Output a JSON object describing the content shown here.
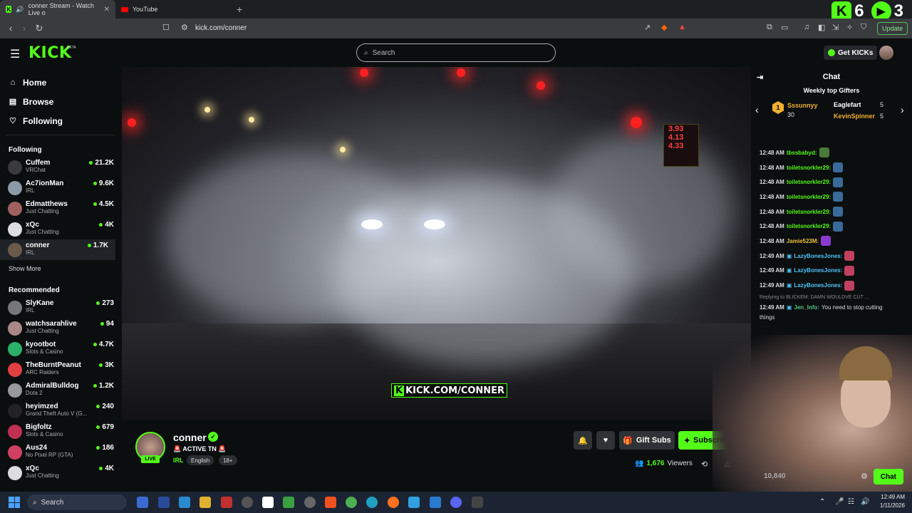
{
  "browser": {
    "tabs": [
      {
        "title": "conner Stream - Watch Live o"
      },
      {
        "title": "YouTube"
      }
    ],
    "url": "kick.com/conner",
    "update_label": "Update",
    "overlay_counts": {
      "kick": "6",
      "play": "3"
    }
  },
  "header": {
    "logo": "KICK",
    "beta": "BETA",
    "search_placeholder": "Search",
    "get_kicks": "Get KICKs"
  },
  "sidebar": {
    "nav": [
      {
        "label": "Home",
        "icon": "home-icon"
      },
      {
        "label": "Browse",
        "icon": "browse-icon"
      },
      {
        "label": "Following",
        "icon": "heart-icon"
      }
    ],
    "following_title": "Following",
    "following": [
      {
        "name": "Cuffem",
        "category": "VRChat",
        "viewers": "21.2K"
      },
      {
        "name": "Ac7ionMan",
        "category": "IRL",
        "viewers": "9.6K"
      },
      {
        "name": "Edmatthews",
        "category": "Just Chatting",
        "viewers": "4.5K"
      },
      {
        "name": "xQc",
        "category": "Just Chatting",
        "viewers": "4K"
      },
      {
        "name": "conner",
        "category": "IRL",
        "viewers": "1.7K"
      }
    ],
    "show_more": "Show More",
    "recommended_title": "Recommended",
    "recommended": [
      {
        "name": "SlyKane",
        "category": "IRL",
        "viewers": "273"
      },
      {
        "name": "watchsarahlive",
        "category": "Just Chatting",
        "viewers": "94"
      },
      {
        "name": "kyootbot",
        "category": "Slots & Casino",
        "viewers": "4.7K"
      },
      {
        "name": "TheBurntPeanut",
        "category": "ARC Raiders",
        "viewers": "3K"
      },
      {
        "name": "AdmiralBulldog",
        "category": "Dota 2",
        "viewers": "1.2K"
      },
      {
        "name": "heyimzed",
        "category": "Grand Theft Auto V (G...",
        "viewers": "240"
      },
      {
        "name": "Bigfoltz",
        "category": "Slots & Casino",
        "viewers": "679"
      },
      {
        "name": "Aus24",
        "category": "No Pixel RP (GTA)",
        "viewers": "186"
      },
      {
        "name": "xQc",
        "category": "Just Chatting",
        "viewers": "4K"
      }
    ]
  },
  "video": {
    "watermark": "KICK.COM/CONNER",
    "gas_prices": [
      "3.93",
      "4.13",
      "4.33"
    ]
  },
  "stream": {
    "name": "conner",
    "title": "🚨 ACTIVE TN 🚨",
    "category": "IRL",
    "tags": [
      "English",
      "18+"
    ],
    "live": "LIVE",
    "gift_subs": "Gift Subs",
    "subscribe": "Subscribe",
    "viewers": "1,676",
    "viewers_label": "Viewers"
  },
  "chat": {
    "title": "Chat",
    "gifters_title": "Weekly top Gifters",
    "gifters": [
      {
        "rank": "1",
        "name": "Sssunnyy",
        "count": "30"
      },
      {
        "name": "Eaglefart",
        "count": "5"
      },
      {
        "name": "KevinSpinner",
        "count": "5"
      }
    ],
    "messages": [
      {
        "time": "12:48 AM",
        "user": "tbssbabyd:",
        "color": "#53fc18"
      },
      {
        "time": "12:48 AM",
        "user": "toiletsnorkler29:",
        "color": "#53fc18"
      },
      {
        "time": "12:48 AM",
        "user": "toiletsnorkler29:",
        "color": "#53fc18"
      },
      {
        "time": "12:48 AM",
        "user": "toiletsnorkler29:",
        "color": "#53fc18"
      },
      {
        "time": "12:48 AM",
        "user": "toiletsnorkler29:",
        "color": "#53fc18"
      },
      {
        "time": "12:48 AM",
        "user": "toiletsnorkler29:",
        "color": "#53fc18"
      },
      {
        "time": "12:48 AM",
        "user": "Jamie523M:",
        "color": "#f0c040"
      },
      {
        "time": "12:49 AM",
        "user": "LazyBonesJones:",
        "color": "#4fc3f7"
      },
      {
        "time": "12:49 AM",
        "user": "LazyBonesJones:",
        "color": "#4fc3f7"
      },
      {
        "time": "12:49 AM",
        "user": "LazyBonesJones:",
        "color": "#4fc3f7"
      }
    ],
    "reply_to": "Replying to BLICKEM: DAMN WOULDVE CUT ...",
    "last_time": "12:49 AM",
    "last_user": "Jen_Info:",
    "last_text": "You need to stop cutting",
    "last_text2": "things",
    "points": "10,840",
    "chat_button": "Chat"
  },
  "taskbar": {
    "search": "Search",
    "time": "12:49 AM",
    "date": "1/11/2026"
  }
}
